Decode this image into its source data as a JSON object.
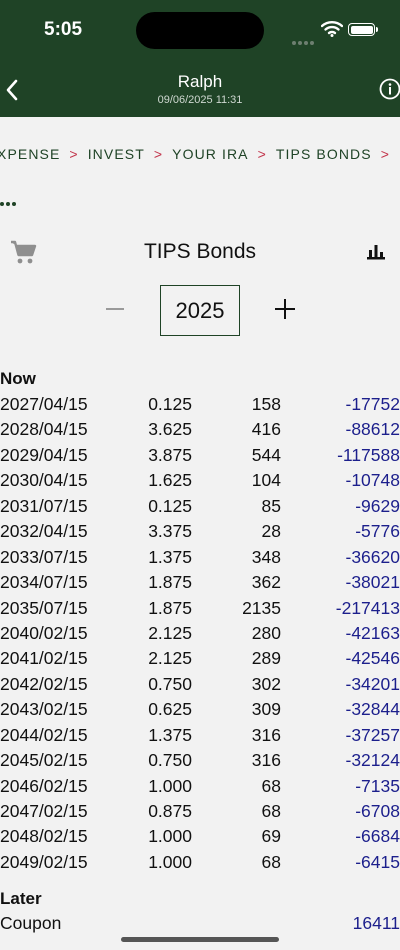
{
  "status": {
    "time": "5:05"
  },
  "nav": {
    "title": "Ralph",
    "subtitle": "09/06/2025 11:31"
  },
  "breadcrumb": [
    "XPENSE",
    "INVEST",
    "YOUR IRA",
    "TIPS BONDS"
  ],
  "breadcrumb_sep": ">",
  "page": {
    "title": "TIPS Bonds",
    "year": "2025"
  },
  "sections": {
    "now": "Now",
    "later": "Later"
  },
  "rows": [
    {
      "date": "2027/04/15",
      "rate": "0.125",
      "qty": "158",
      "value": "-17752"
    },
    {
      "date": "2028/04/15",
      "rate": "3.625",
      "qty": "416",
      "value": "-88612"
    },
    {
      "date": "2029/04/15",
      "rate": "3.875",
      "qty": "544",
      "value": "-117588"
    },
    {
      "date": "2030/04/15",
      "rate": "1.625",
      "qty": "104",
      "value": "-10748"
    },
    {
      "date": "2031/07/15",
      "rate": "0.125",
      "qty": "85",
      "value": "-9629"
    },
    {
      "date": "2032/04/15",
      "rate": "3.375",
      "qty": "28",
      "value": "-5776"
    },
    {
      "date": "2033/07/15",
      "rate": "1.375",
      "qty": "348",
      "value": "-36620"
    },
    {
      "date": "2034/07/15",
      "rate": "1.875",
      "qty": "362",
      "value": "-38021"
    },
    {
      "date": "2035/07/15",
      "rate": "1.875",
      "qty": "2135",
      "value": "-217413"
    },
    {
      "date": "2040/02/15",
      "rate": "2.125",
      "qty": "280",
      "value": "-42163"
    },
    {
      "date": "2041/02/15",
      "rate": "2.125",
      "qty": "289",
      "value": "-42546"
    },
    {
      "date": "2042/02/15",
      "rate": "0.750",
      "qty": "302",
      "value": "-34201"
    },
    {
      "date": "2043/02/15",
      "rate": "0.625",
      "qty": "309",
      "value": "-32844"
    },
    {
      "date": "2044/02/15",
      "rate": "1.375",
      "qty": "316",
      "value": "-37257"
    },
    {
      "date": "2045/02/15",
      "rate": "0.750",
      "qty": "316",
      "value": "-32124"
    },
    {
      "date": "2046/02/15",
      "rate": "1.000",
      "qty": "68",
      "value": "-7135"
    },
    {
      "date": "2047/02/15",
      "rate": "0.875",
      "qty": "68",
      "value": "-6708"
    },
    {
      "date": "2048/02/15",
      "rate": "1.000",
      "qty": "69",
      "value": "-6684"
    },
    {
      "date": "2049/02/15",
      "rate": "1.000",
      "qty": "68",
      "value": "-6415"
    }
  ],
  "later_rows": [
    {
      "label": "Coupon",
      "value": "16411"
    }
  ],
  "colors": {
    "header": "#1f4326",
    "value": "#1c1f8c",
    "separator": "#c2334a"
  },
  "icons": {
    "back": "chevron-left-icon",
    "info": "info-circle-icon",
    "cart": "cart-icon",
    "chart": "bar-chart-icon"
  }
}
